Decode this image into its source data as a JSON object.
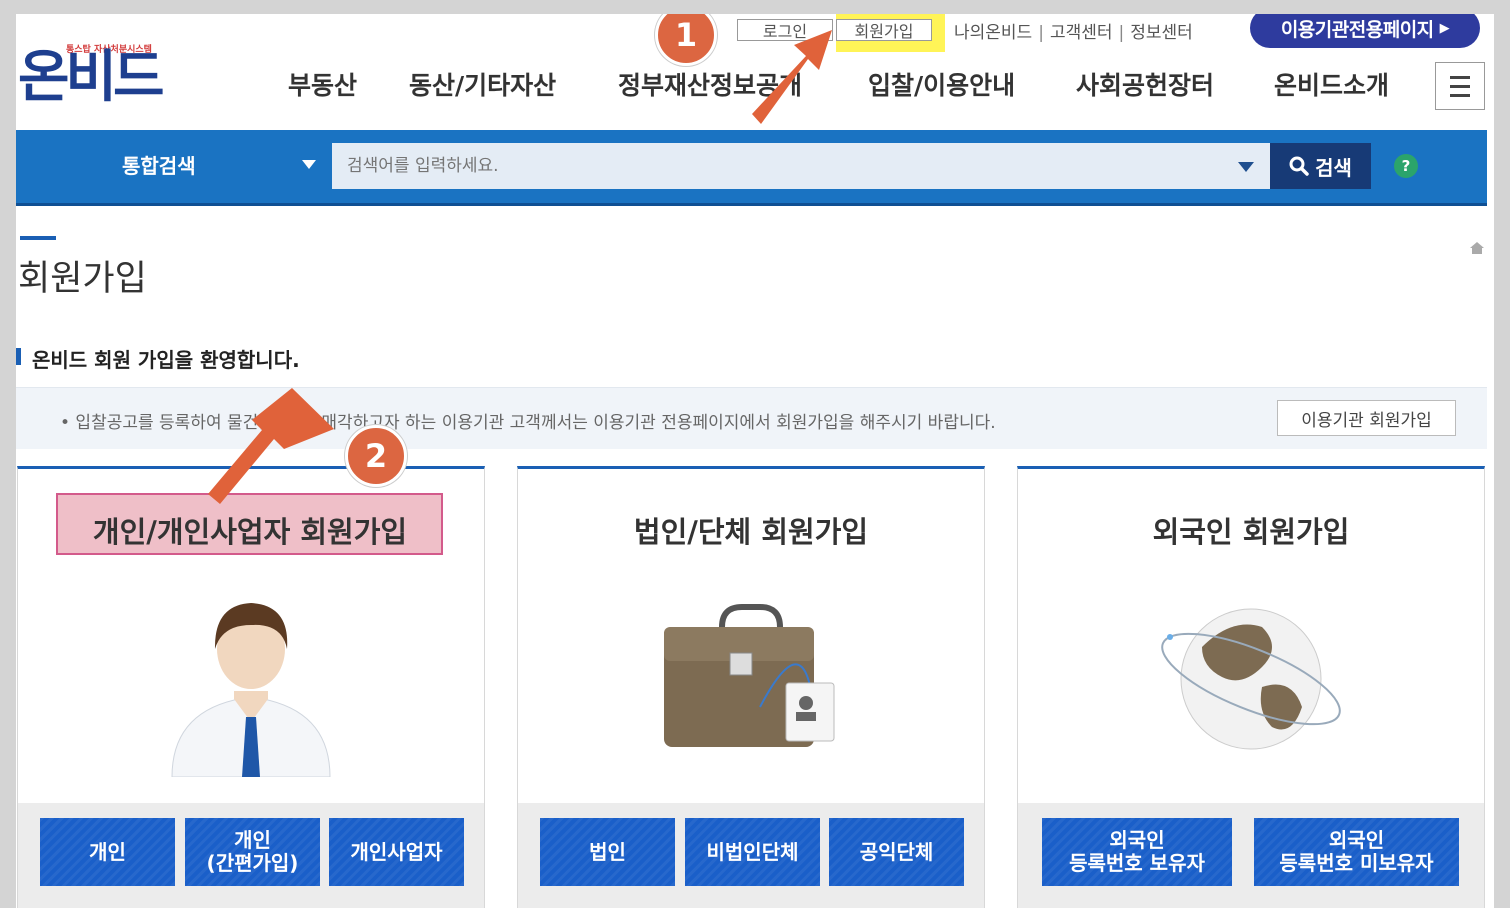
{
  "util": {
    "login": "로그인",
    "join": "회원가입",
    "links": [
      "나의온비드",
      "고객센터",
      "정보센터"
    ],
    "link_separator": "|",
    "institution_page": "이용기관전용페이지"
  },
  "logo": {
    "tagline": "통스탑 자산처분시스템",
    "name": "온비드"
  },
  "gnb": [
    "부동산",
    "동산/기타자산",
    "정부재산정보공개",
    "입찰/이용안내",
    "사회공헌장터",
    "온비드소개"
  ],
  "search": {
    "category": "통합검색",
    "placeholder": "검색어를 입력하세요.",
    "button": "검색",
    "help": "?"
  },
  "page": {
    "title": "회원가입",
    "welcome": "온비드 회원 가입을 환영합니다.",
    "notice": "• 입찰공고를 등록하여 물건을 처분, 매각하고자 하는 이용기관 고객께서는 이용기관 전용페이지에서 회원가입을 해주시기 바랍니다.",
    "institution_join": "이용기관 회원가입"
  },
  "cards": [
    {
      "title": "개인/개인사업자 회원가입",
      "buttons": [
        "개인",
        "개인\n(간편가입)",
        "개인사업자"
      ]
    },
    {
      "title": "법인/단체 회원가입",
      "buttons": [
        "법인",
        "비법인단체",
        "공익단체"
      ]
    },
    {
      "title": "외국인 회원가입",
      "buttons": [
        "외국인\n등록번호 보유자",
        "외국인\n등록번호 미보유자"
      ]
    }
  ],
  "annotations": {
    "step1": "1",
    "step2": "2"
  },
  "colors": {
    "primary": "#1a73c2",
    "navy": "#173a76",
    "accent": "#dc6641",
    "highlight": "#fff23a",
    "institution": "#2e3b9e"
  }
}
